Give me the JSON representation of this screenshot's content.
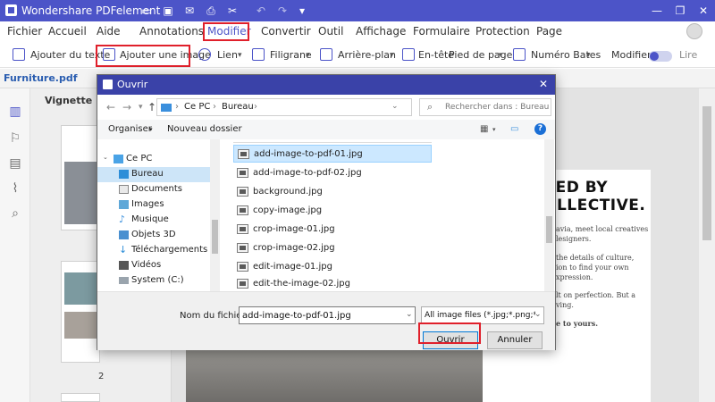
{
  "app": {
    "title": "Wondershare PDFelement"
  },
  "menu": {
    "items": [
      "Fichier",
      "Accueil",
      "Aide",
      "Annotations",
      "Modifier",
      "Convertir",
      "Outil",
      "Affichage",
      "Formulaire",
      "Protection",
      "Page"
    ],
    "active": "Modifier"
  },
  "toolbar": {
    "add_text": "Ajouter du texte",
    "add_image": "Ajouter une image",
    "link": "Lien",
    "watermark": "Filigrane",
    "background": "Arrière-plan",
    "header": "En-tête",
    "footer": "Pied de page",
    "bates": "Numéro Bates",
    "edit_mode": "Modifier",
    "read_mode": "Lire"
  },
  "document": {
    "tab": "Furniture.pdf",
    "heading_line1": "RED BY",
    "heading_line2": "OLLECTIVE.",
    "body_lines": [
      "avia, meet local creatives",
      "lesigners.",
      "the details of culture,",
      "ion to find your own",
      "xpression.",
      "lt on perfection. But a",
      "ving.",
      "e to yours."
    ]
  },
  "sidebar": {
    "title": "Vignette",
    "page_number": "2"
  },
  "dialog": {
    "title": "Ouvrir",
    "breadcrumb": [
      "Ce PC",
      "Bureau"
    ],
    "search_placeholder": "Rechercher dans : Bureau",
    "organize": "Organiser",
    "new_folder": "Nouveau dossier",
    "nav_items": [
      {
        "label": "Ce PC",
        "icon": "computer-icon"
      },
      {
        "label": "Bureau",
        "icon": "desktop-folder-icon",
        "selected": true
      },
      {
        "label": "Documents",
        "icon": "documents-folder-icon"
      },
      {
        "label": "Images",
        "icon": "pictures-folder-icon"
      },
      {
        "label": "Musique",
        "icon": "music-folder-icon"
      },
      {
        "label": "Objets 3D",
        "icon": "3d-objects-folder-icon"
      },
      {
        "label": "Téléchargements",
        "icon": "downloads-folder-icon"
      },
      {
        "label": "Vidéos",
        "icon": "videos-folder-icon"
      },
      {
        "label": "System (C:)",
        "icon": "drive-icon"
      }
    ],
    "files": [
      {
        "name": "add-image-to-pdf-01.jpg",
        "selected": true
      },
      {
        "name": "add-image-to-pdf-02.jpg"
      },
      {
        "name": "background.jpg"
      },
      {
        "name": "copy-image.jpg"
      },
      {
        "name": "crop-image-01.jpg"
      },
      {
        "name": "crop-image-02.jpg"
      },
      {
        "name": "edit-image-01.jpg"
      },
      {
        "name": "edit-the-image-02.jpg"
      }
    ],
    "filename_label": "Nom du fichier :",
    "filename_value": "add-image-to-pdf-01.jpg",
    "filter_value": "All image files (*.jpg;*.png;*.tif;*",
    "open_button": "Ouvrir",
    "cancel_button": "Annuler"
  },
  "colors": {
    "accent": "#4c54c8",
    "highlight": "#e0202b",
    "selection": "#cce8ff"
  }
}
